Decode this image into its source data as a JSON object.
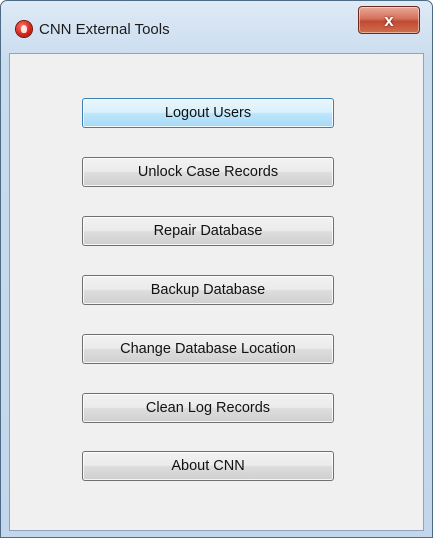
{
  "window": {
    "title": "CNN External Tools",
    "close_label": "x"
  },
  "buttons": [
    {
      "label": "Logout Users",
      "focused": true
    },
    {
      "label": "Unlock Case Records"
    },
    {
      "label": "Repair Database"
    },
    {
      "label": "Backup Database"
    },
    {
      "label": "Change Database Location"
    },
    {
      "label": "Clean Log Records"
    },
    {
      "label": "About CNN"
    }
  ]
}
